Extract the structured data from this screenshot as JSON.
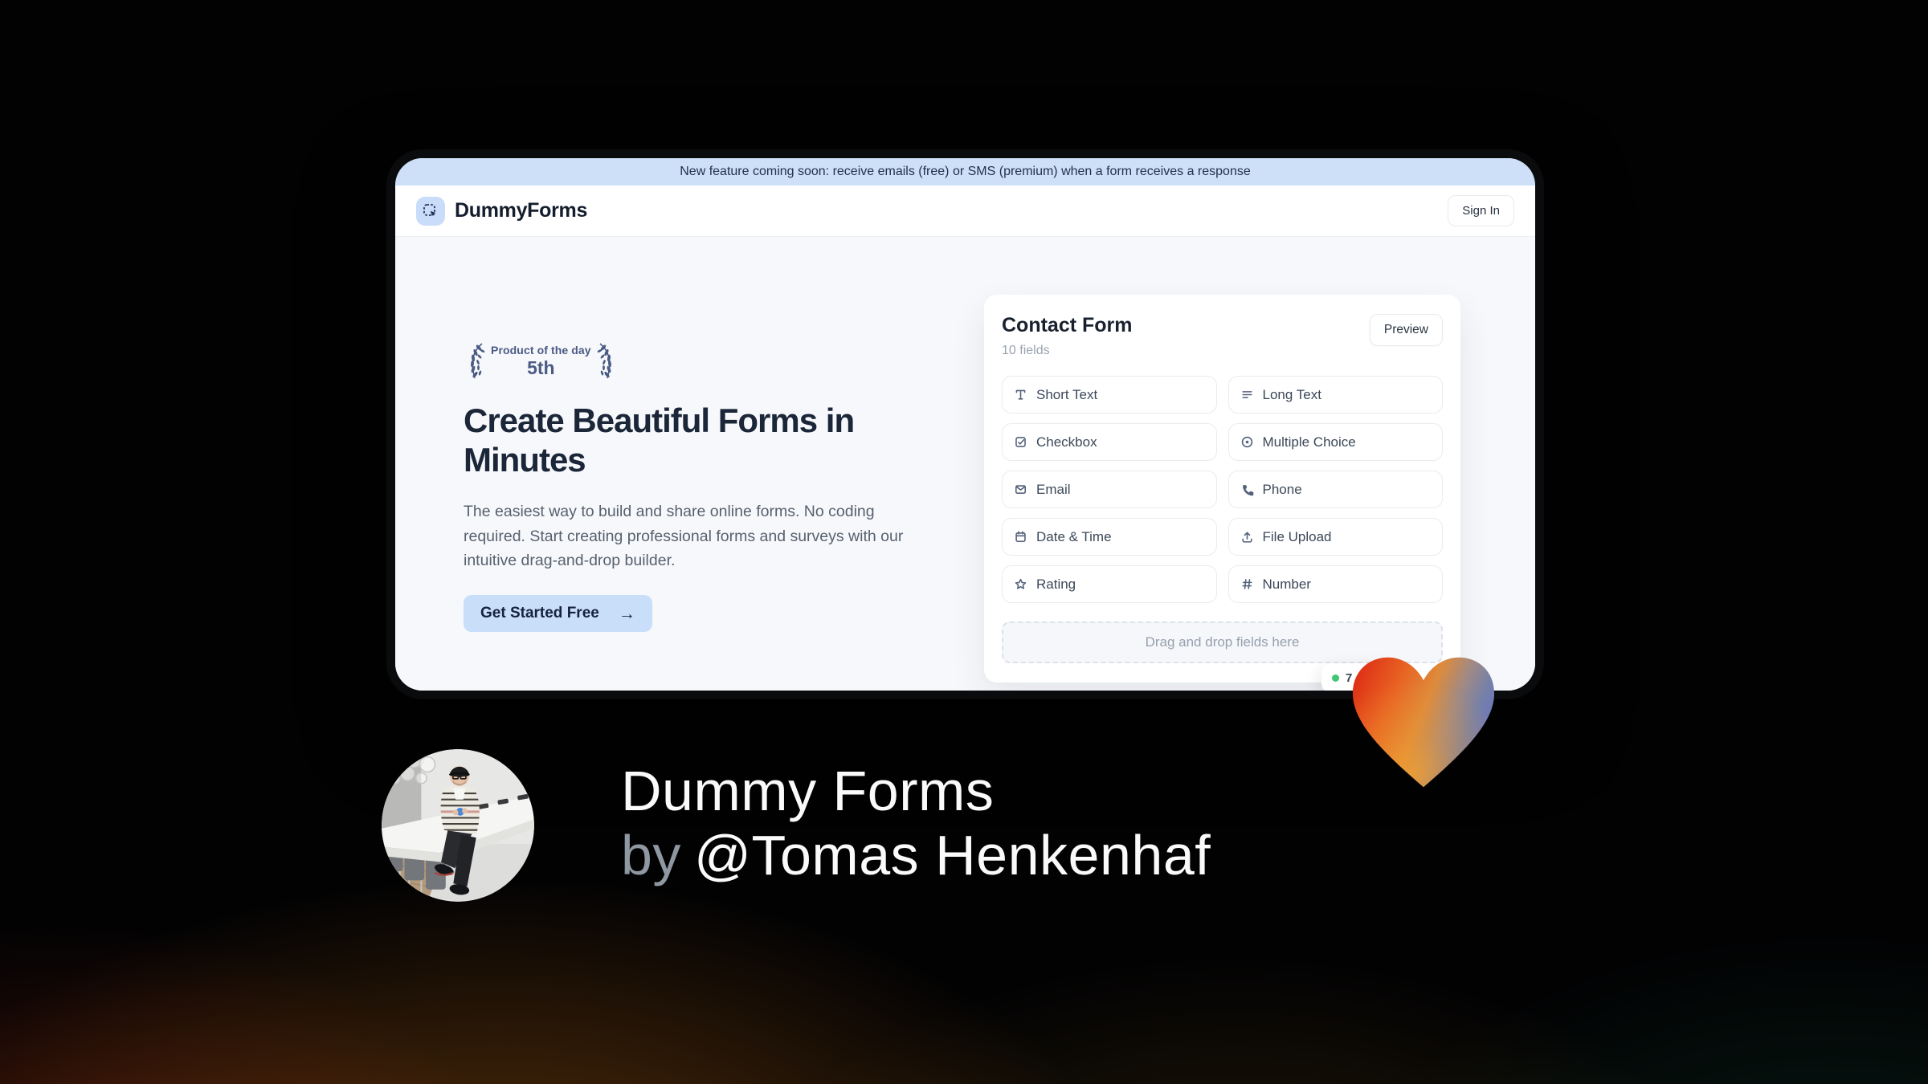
{
  "banner": {
    "text": "New feature coming soon: receive emails (free) or SMS (premium) when a form receives a response"
  },
  "header": {
    "brand": "DummyForms",
    "sign_in_label": "Sign In"
  },
  "hero": {
    "award_line1": "Product of the day",
    "award_line2": "5th",
    "title": "Create Beautiful Forms in Minutes",
    "description": "The easiest way to build and share online forms. No coding required. Start creating professional forms and surveys with our intuitive drag-and-drop builder.",
    "cta_label": "Get Started Free",
    "cta_arrow": "→"
  },
  "builder": {
    "title": "Contact Form",
    "field_count": "10 fields",
    "preview_label": "Preview",
    "fields": [
      {
        "label": "Short Text",
        "icon": "short-text-icon"
      },
      {
        "label": "Long Text",
        "icon": "long-text-icon"
      },
      {
        "label": "Checkbox",
        "icon": "checkbox-icon"
      },
      {
        "label": "Multiple Choice",
        "icon": "radio-icon"
      },
      {
        "label": "Email",
        "icon": "mail-icon"
      },
      {
        "label": "Phone",
        "icon": "phone-icon"
      },
      {
        "label": "Date & Time",
        "icon": "calendar-icon"
      },
      {
        "label": "File Upload",
        "icon": "upload-icon"
      },
      {
        "label": "Rating",
        "icon": "star-icon"
      },
      {
        "label": "Number",
        "icon": "hash-icon"
      }
    ],
    "dropzone_text": "Drag and drop fields here",
    "response_badge": "7"
  },
  "caption": {
    "product": "Dummy Forms",
    "byword": "by",
    "author": "@Tomas Henkenhaf"
  },
  "colors": {
    "banner_bg": "#cedff8",
    "accent_blue": "#c9def9",
    "navy": "#1b2638",
    "body_bg": "#f7f8fb",
    "badge_green": "#3fc873",
    "heart_red": "#e03318",
    "heart_orange": "#ee9a2d",
    "heart_blue": "#6a72c8"
  }
}
